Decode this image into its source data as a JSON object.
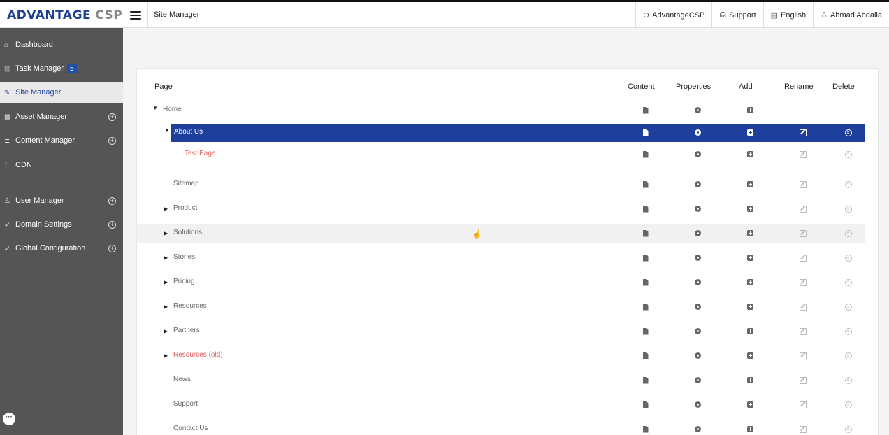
{
  "app": {
    "logo_main": "ADVANTAGE",
    "logo_sub": "CSP"
  },
  "header": {
    "title": "Site Manager",
    "items": [
      {
        "icon": "globe-icon",
        "label": "AdvantageCSP"
      },
      {
        "icon": "headset-icon",
        "label": "Support"
      },
      {
        "icon": "language-icon",
        "label": "English"
      },
      {
        "icon": "user-icon",
        "label": "Ahmad Abdalla"
      }
    ]
  },
  "sidebar": {
    "items": [
      {
        "label": "Dashboard",
        "icon": "home-icon"
      },
      {
        "label": "Task Manager",
        "icon": "tasks-icon",
        "badge": "5"
      },
      {
        "label": "Site Manager",
        "icon": "pencil-icon",
        "active": true
      },
      {
        "label": "Asset Manager",
        "icon": "grid-icon",
        "expandable": true
      },
      {
        "label": "Content Manager",
        "icon": "database-icon",
        "expandable": true
      },
      {
        "label": "CDN",
        "icon": "fork-icon"
      },
      {
        "label": "User Manager",
        "icon": "users-icon",
        "expandable": true
      },
      {
        "label": "Domain Settings",
        "icon": "rocket-icon",
        "expandable": true
      },
      {
        "label": "Global Configuration",
        "icon": "rocket-icon",
        "expandable": true
      }
    ],
    "expand_symbol": "+",
    "chat_symbol": "···"
  },
  "columns": {
    "page": "Page",
    "content": "Content",
    "properties": "Properties",
    "add": "Add",
    "rename": "Rename",
    "delete": "Delete"
  },
  "pages": [
    {
      "label": "Home",
      "level": 0,
      "expanded": true
    },
    {
      "label": "About Us",
      "level": 1,
      "expanded": true,
      "selected": true
    },
    {
      "label": "Test Page",
      "level": 2,
      "red": true
    },
    {
      "label": "Sitemap",
      "level": 1
    },
    {
      "label": "Product",
      "level": 1,
      "collapsed": true
    },
    {
      "label": "Solutions",
      "level": 1,
      "collapsed": true,
      "hover": true
    },
    {
      "label": "Stories",
      "level": 1,
      "collapsed": true
    },
    {
      "label": "Pricing",
      "level": 1,
      "collapsed": true
    },
    {
      "label": "Resources",
      "level": 1,
      "collapsed": true
    },
    {
      "label": "Partners",
      "level": 1,
      "collapsed": true
    },
    {
      "label": "Resources (old)",
      "level": 1,
      "collapsed": true,
      "red": true
    },
    {
      "label": "News",
      "level": 1
    },
    {
      "label": "Support",
      "level": 1
    },
    {
      "label": "Contact Us",
      "level": 1
    }
  ],
  "colors": {
    "brand": "#1f3f8f",
    "selected_row": "#1f3f9c",
    "sidebar_bg": "#555555",
    "badge": "#1f4fa8"
  }
}
